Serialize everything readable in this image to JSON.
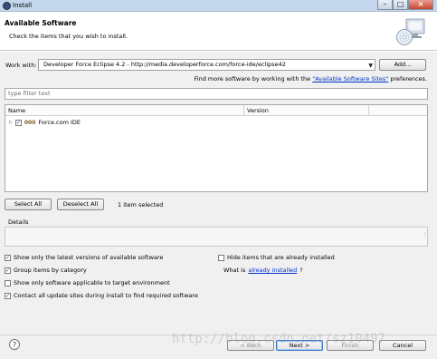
{
  "window": {
    "title": "Install"
  },
  "header": {
    "title": "Available Software",
    "description": "Check the items that you wish to install."
  },
  "work_with": {
    "label": "Work with:",
    "value": "Developer Force Eclipse 4.2 - http://media.developerforce.com/force-ide/eclipse42",
    "add_button": "Add...",
    "more_prefix": "Find more software by working with the ",
    "more_link": "\"Available Software Sites\"",
    "more_suffix": " preferences."
  },
  "filter": {
    "placeholder": "type filter text"
  },
  "table": {
    "columns": [
      "Name",
      "Version"
    ],
    "rows": [
      {
        "name": "Force.com IDE",
        "version": "",
        "checked": true
      }
    ]
  },
  "selection": {
    "select_all": "Select All",
    "deselect_all": "Deselect All",
    "status": "1 item selected"
  },
  "details": {
    "label": "Details"
  },
  "options": {
    "latest_versions": {
      "label": "Show only the latest versions of available software",
      "checked": true
    },
    "hide_installed": {
      "label": "Hide items that are already installed",
      "checked": false
    },
    "group_by_category": {
      "label": "Group items by category",
      "checked": true
    },
    "what_is_prefix": "What is ",
    "what_is_link": "already installed",
    "what_is_suffix": "?",
    "applicable_only": {
      "label": "Show only software applicable to target environment",
      "checked": false
    },
    "contact_sites": {
      "label": "Contact all update sites during install to find required software",
      "checked": true
    }
  },
  "footer": {
    "help": "?",
    "back": "< Back",
    "next": "Next >",
    "finish": "Finish",
    "cancel": "Cancel"
  },
  "watermark": "http://blog.csdn.net/sz10497"
}
